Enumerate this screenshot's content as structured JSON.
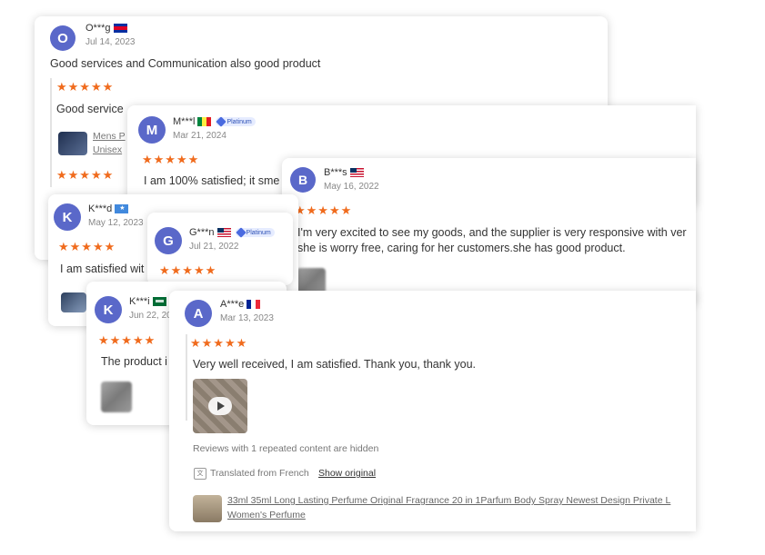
{
  "reviews": [
    {
      "initial": "O",
      "name": "O***g",
      "date": "Jul 14, 2023",
      "text": "Good services and Communication also good product",
      "followup_text": "Good service",
      "product_line1": "Mens P",
      "product_line2": "Unisex"
    },
    {
      "initial": "M",
      "name": "M***l",
      "badge": "Platinum",
      "date": "Mar 21, 2024",
      "text": "I am 100% satisfied; it sme"
    },
    {
      "initial": "B",
      "name": "B***s",
      "date": "May 16, 2022",
      "text_line1": "I'm very excited to see my goods, and the supplier is very responsive with ver",
      "text_line2": "she is worry free, caring for her customers.she has good product."
    },
    {
      "initial": "K",
      "name": "K***d",
      "date": "May 12, 2023",
      "text": "I am satisfied wit"
    },
    {
      "initial": "G",
      "name": "G***n",
      "badge": "Platinum",
      "date": "Jul 21, 2022"
    },
    {
      "initial": "K",
      "name": "K***i",
      "date": "Jun 22, 20",
      "text": "The product i"
    },
    {
      "initial": "A",
      "name": "A***e",
      "date": "Mar 13, 2023",
      "text": "Very well received, I am satisfied. Thank you, thank you.",
      "hidden_note": "Reviews with 1 repeated content are hidden",
      "translated_label": "Translated from French",
      "show_original": "Show original",
      "product_line1": "33ml 35ml Long Lasting Perfume Original Fragrance 20 in 1Parfum Body Spray Newest Design Private L",
      "product_line2": "Women's Perfume"
    }
  ],
  "stars": "★★★★★",
  "colors": {
    "avatar": "#5a68c9",
    "star": "#f06b1d"
  }
}
